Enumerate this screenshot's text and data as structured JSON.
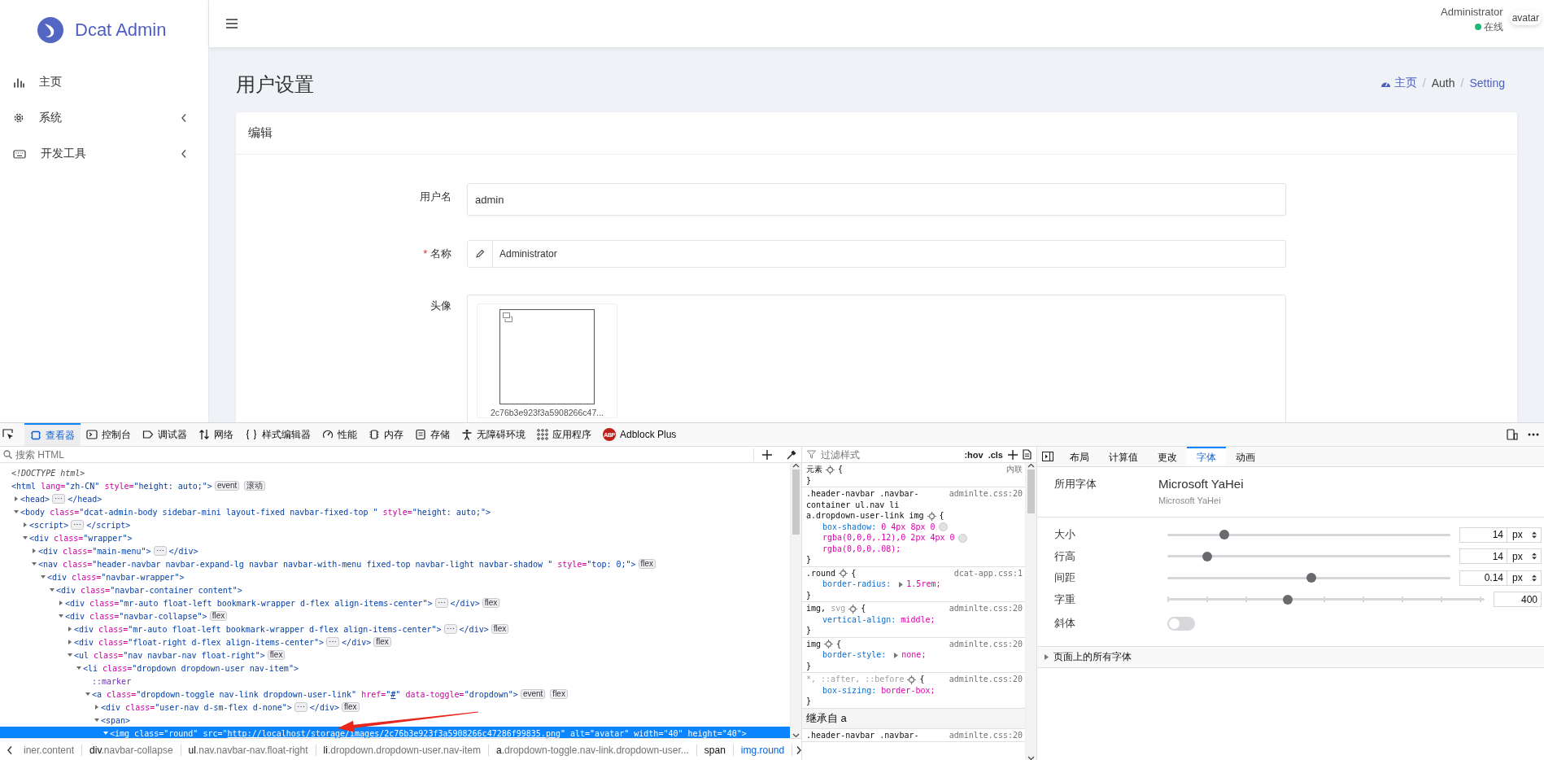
{
  "sidebar": {
    "logo": "Dcat Admin",
    "items": [
      {
        "label": "主页",
        "expandable": false
      },
      {
        "label": "系统",
        "expandable": true
      },
      {
        "label": "开发工具",
        "expandable": true
      }
    ]
  },
  "header": {
    "user_name": "Administrator",
    "status": "在线",
    "avatar_alt": "avatar"
  },
  "content": {
    "title": "用户设置",
    "breadcrumb": [
      {
        "kind": "link",
        "label": "主页"
      },
      {
        "kind": "separator",
        "label": "/"
      },
      {
        "kind": "text",
        "label": "Auth"
      },
      {
        "kind": "separator",
        "label": "/"
      },
      {
        "kind": "link",
        "label": "Setting"
      }
    ],
    "card": {
      "title": "编辑",
      "fields": [
        {
          "kind": "text",
          "label": "用户名",
          "value": "admin"
        },
        {
          "kind": "icon-text",
          "label": "名称",
          "mark": "*",
          "value": "Administrator"
        },
        {
          "kind": "image",
          "label": "头像",
          "file_name": "2c76b3e923f3a5908266c47..."
        }
      ]
    }
  },
  "devtools": {
    "toolbar": {
      "tabs": [
        {
          "label": "查看器",
          "selected": true
        },
        {
          "label": "控制台",
          "selected": false
        },
        {
          "label": "调试器",
          "selected": false
        },
        {
          "label": "网络",
          "selected": false
        },
        {
          "label": "样式编辑器",
          "selected": false
        },
        {
          "label": "性能",
          "selected": false
        },
        {
          "label": "内存",
          "selected": false
        },
        {
          "label": "存储",
          "selected": false
        },
        {
          "label": "无障碍环境",
          "selected": false
        },
        {
          "label": "应用程序",
          "selected": false
        },
        {
          "label": "Adblock Plus",
          "selected": false,
          "badge": "ABP"
        }
      ]
    },
    "inspector": {
      "search_placeholder": "搜索 HTML",
      "tree": [
        {
          "selected": false,
          "parts": [
            {
              "kind": "doctype",
              "text": "<!DOCTYPE html>"
            }
          ]
        },
        {
          "selected": false,
          "parts": [
            {
              "kind": "tag",
              "text": "<html"
            },
            {
              "kind": "attr",
              "text": " lang="
            },
            {
              "kind": "value",
              "text": "\"zh-CN\""
            },
            {
              "kind": "attr",
              "text": " style="
            },
            {
              "kind": "value",
              "text": "\"height: auto;\""
            },
            {
              "kind": "tag",
              "text": ">"
            },
            {
              "kind": "badge",
              "text": "event"
            },
            {
              "kind": "badge",
              "text": "滚动"
            }
          ],
          "children": [
            {
              "selected": false,
              "expanded": false,
              "parts": [
                {
                  "kind": "tag",
                  "text": "<head>"
                },
                {
                  "kind": "badge",
                  "text": "⋯"
                },
                {
                  "kind": "tag",
                  "text": "</head>"
                }
              ]
            },
            {
              "selected": false,
              "expanded": true,
              "parts": [
                {
                  "kind": "tag",
                  "text": "<body"
                },
                {
                  "kind": "attr",
                  "text": " class="
                },
                {
                  "kind": "value",
                  "text": "\"dcat-admin-body sidebar-mini layout-fixed navbar-fixed-top \""
                },
                {
                  "kind": "attr",
                  "text": " style="
                },
                {
                  "kind": "value",
                  "text": "\"height: auto;\""
                },
                {
                  "kind": "tag",
                  "text": ">"
                }
              ],
              "children": [
                {
                  "selected": false,
                  "expanded": false,
                  "parts": [
                    {
                      "kind": "tag",
                      "text": "<script>"
                    },
                    {
                      "kind": "badge",
                      "text": "⋯"
                    },
                    {
                      "kind": "tag",
                      "text": "</script>"
                    }
                  ]
                },
                {
                  "selected": false,
                  "expanded": true,
                  "parts": [
                    {
                      "kind": "tag",
                      "text": "<div"
                    },
                    {
                      "kind": "attr",
                      "text": " class="
                    },
                    {
                      "kind": "value",
                      "text": "\"wrapper\""
                    },
                    {
                      "kind": "tag",
                      "text": ">"
                    }
                  ],
                  "children": [
                    {
                      "selected": false,
                      "expanded": false,
                      "parts": [
                        {
                          "kind": "tag",
                          "text": "<div"
                        },
                        {
                          "kind": "attr",
                          "text": " class="
                        },
                        {
                          "kind": "value",
                          "text": "\"main-menu\""
                        },
                        {
                          "kind": "tag",
                          "text": ">"
                        },
                        {
                          "kind": "badge",
                          "text": "⋯"
                        },
                        {
                          "kind": "tag",
                          "text": "</div>"
                        }
                      ]
                    },
                    {
                      "selected": false,
                      "expanded": true,
                      "parts": [
                        {
                          "kind": "tag",
                          "text": "<nav"
                        },
                        {
                          "kind": "attr",
                          "text": " class="
                        },
                        {
                          "kind": "value",
                          "text": "\"header-navbar navbar-expand-lg navbar navbar-with-menu fixed-top navbar-light navbar-shadow \""
                        },
                        {
                          "kind": "attr",
                          "text": " style="
                        },
                        {
                          "kind": "value",
                          "text": "\"top: 0;\""
                        },
                        {
                          "kind": "tag",
                          "text": ">"
                        },
                        {
                          "kind": "badge",
                          "text": "flex"
                        }
                      ],
                      "children": [
                        {
                          "selected": false,
                          "expanded": true,
                          "parts": [
                            {
                              "kind": "tag",
                              "text": "<div"
                            },
                            {
                              "kind": "attr",
                              "text": " class="
                            },
                            {
                              "kind": "value",
                              "text": "\"navbar-wrapper\""
                            },
                            {
                              "kind": "tag",
                              "text": ">"
                            }
                          ],
                          "children": [
                            {
                              "selected": false,
                              "expanded": true,
                              "parts": [
                                {
                                  "kind": "tag",
                                  "text": "<div"
                                },
                                {
                                  "kind": "attr",
                                  "text": " class="
                                },
                                {
                                  "kind": "value",
                                  "text": "\"navbar-container content\""
                                },
                                {
                                  "kind": "tag",
                                  "text": ">"
                                }
                              ],
                              "children": [
                                {
                                  "selected": false,
                                  "expanded": false,
                                  "parts": [
                                    {
                                      "kind": "tag",
                                      "text": "<div"
                                    },
                                    {
                                      "kind": "attr",
                                      "text": " class="
                                    },
                                    {
                                      "kind": "value",
                                      "text": "\"mr-auto float-left bookmark-wrapper d-flex align-items-center\""
                                    },
                                    {
                                      "kind": "tag",
                                      "text": ">"
                                    },
                                    {
                                      "kind": "badge",
                                      "text": "⋯"
                                    },
                                    {
                                      "kind": "tag",
                                      "text": "</div>"
                                    },
                                    {
                                      "kind": "badge",
                                      "text": "flex"
                                    }
                                  ]
                                },
                                {
                                  "selected": false,
                                  "expanded": true,
                                  "parts": [
                                    {
                                      "kind": "tag",
                                      "text": "<div"
                                    },
                                    {
                                      "kind": "attr",
                                      "text": " class="
                                    },
                                    {
                                      "kind": "value",
                                      "text": "\"navbar-collapse\""
                                    },
                                    {
                                      "kind": "tag",
                                      "text": ">"
                                    },
                                    {
                                      "kind": "badge",
                                      "text": "flex"
                                    }
                                  ],
                                  "children": [
                                    {
                                      "selected": false,
                                      "expanded": false,
                                      "parts": [
                                        {
                                          "kind": "tag",
                                          "text": "<div"
                                        },
                                        {
                                          "kind": "attr",
                                          "text": " class="
                                        },
                                        {
                                          "kind": "value",
                                          "text": "\"mr-auto float-left bookmark-wrapper d-flex align-items-center\""
                                        },
                                        {
                                          "kind": "tag",
                                          "text": ">"
                                        },
                                        {
                                          "kind": "badge",
                                          "text": "⋯"
                                        },
                                        {
                                          "kind": "tag",
                                          "text": "</div>"
                                        },
                                        {
                                          "kind": "badge",
                                          "text": "flex"
                                        }
                                      ]
                                    },
                                    {
                                      "selected": false,
                                      "expanded": false,
                                      "parts": [
                                        {
                                          "kind": "tag",
                                          "text": "<div"
                                        },
                                        {
                                          "kind": "attr",
                                          "text": " class="
                                        },
                                        {
                                          "kind": "value",
                                          "text": "\"float-right d-flex align-items-center\""
                                        },
                                        {
                                          "kind": "tag",
                                          "text": ">"
                                        },
                                        {
                                          "kind": "badge",
                                          "text": "⋯"
                                        },
                                        {
                                          "kind": "tag",
                                          "text": "</div>"
                                        },
                                        {
                                          "kind": "badge",
                                          "text": "flex"
                                        }
                                      ]
                                    },
                                    {
                                      "selected": false,
                                      "expanded": true,
                                      "parts": [
                                        {
                                          "kind": "tag",
                                          "text": "<ul"
                                        },
                                        {
                                          "kind": "attr",
                                          "text": " class="
                                        },
                                        {
                                          "kind": "value",
                                          "text": "\"nav navbar-nav float-right\""
                                        },
                                        {
                                          "kind": "tag",
                                          "text": ">"
                                        },
                                        {
                                          "kind": "badge",
                                          "text": "flex"
                                        }
                                      ],
                                      "children": [
                                        {
                                          "selected": false,
                                          "expanded": true,
                                          "parts": [
                                            {
                                              "kind": "tag",
                                              "text": "<li"
                                            },
                                            {
                                              "kind": "attr",
                                              "text": " class="
                                            },
                                            {
                                              "kind": "value",
                                              "text": "\"dropdown dropdown-user nav-item\""
                                            },
                                            {
                                              "kind": "tag",
                                              "text": ">"
                                            }
                                          ],
                                          "children": [
                                            {
                                              "selected": false,
                                              "parts": [
                                                {
                                                  "kind": "pseudo",
                                                  "text": "::marker"
                                                }
                                              ]
                                            },
                                            {
                                              "selected": false,
                                              "expanded": true,
                                              "parts": [
                                                {
                                                  "kind": "tag",
                                                  "text": "<a"
                                                },
                                                {
                                                  "kind": "attr",
                                                  "text": " class="
                                                },
                                                {
                                                  "kind": "value",
                                                  "text": "\"dropdown-toggle nav-link dropdown-user-link\""
                                                },
                                                {
                                                  "kind": "attr",
                                                  "text": " href="
                                                },
                                                {
                                                  "kind": "value",
                                                  "text": "\""
                                                },
                                                {
                                                  "kind": "link",
                                                  "text": "#"
                                                },
                                                {
                                                  "kind": "value",
                                                  "text": "\""
                                                },
                                                {
                                                  "kind": "attr",
                                                  "text": " data-toggle="
                                                },
                                                {
                                                  "kind": "value",
                                                  "text": "\"dropdown\""
                                                },
                                                {
                                                  "kind": "tag",
                                                  "text": ">"
                                                },
                                                {
                                                  "kind": "badge",
                                                  "text": "event"
                                                },
                                                {
                                                  "kind": "badge",
                                                  "text": "flex"
                                                }
                                              ],
                                              "children": [
                                                {
                                                  "selected": false,
                                                  "expanded": false,
                                                  "parts": [
                                                    {
                                                      "kind": "tag",
                                                      "text": "<div"
                                                    },
                                                    {
                                                      "kind": "attr",
                                                      "text": " class="
                                                    },
                                                    {
                                                      "kind": "value",
                                                      "text": "\"user-nav d-sm-flex d-none\""
                                                    },
                                                    {
                                                      "kind": "tag",
                                                      "text": ">"
                                                    },
                                                    {
                                                      "kind": "badge",
                                                      "text": "⋯"
                                                    },
                                                    {
                                                      "kind": "tag",
                                                      "text": "</div>"
                                                    },
                                                    {
                                                      "kind": "badge",
                                                      "text": "flex"
                                                    }
                                                  ]
                                                },
                                                {
                                                  "selected": false,
                                                  "expanded": true,
                                                  "parts": [
                                                    {
                                                      "kind": "tag",
                                                      "text": "<span>"
                                                    }
                                                  ],
                                                  "children": [
                                                    {
                                                      "selected": true,
                                                      "expanded": true,
                                                      "parts": [
                                                        {
                                                          "kind": "tag",
                                                          "text": "<img"
                                                        },
                                                        {
                                                          "kind": "attr",
                                                          "text": " class="
                                                        },
                                                        {
                                                          "kind": "value",
                                                          "text": "\"round\""
                                                        },
                                                        {
                                                          "kind": "attr",
                                                          "text": " src="
                                                        },
                                                        {
                                                          "kind": "value",
                                                          "text": "\""
                                                        },
                                                        {
                                                          "kind": "link",
                                                          "text": "http://localhost/storage/images/2c76b3e923f3a5908266c47286f99835.png"
                                                        },
                                                        {
                                                          "kind": "value",
                                                          "text": "\""
                                                        },
                                                        {
                                                          "kind": "attr",
                                                          "text": " alt="
                                                        },
                                                        {
                                                          "kind": "value",
                                                          "text": "\"avatar\""
                                                        },
                                                        {
                                                          "kind": "attr",
                                                          "text": " width="
                                                        },
                                                        {
                                                          "kind": "value",
                                                          "text": "\"40\""
                                                        },
                                                        {
                                                          "kind": "attr",
                                                          "text": " height="
                                                        },
                                                        {
                                                          "kind": "value",
                                                          "text": "\"40\""
                                                        },
                                                        {
                                                          "kind": "tag",
                                                          "text": ">"
                                                        }
                                                      ]
                                                    }
                                                  ]
                                                }
                                              ]
                                            }
                                          ]
                                        }
                                      ]
                                    }
                                  ]
                                }
                              ]
                            }
                          ]
                        }
                      ]
                    }
                  ]
                }
              ]
            }
          ]
        }
      ],
      "breadcrumb": [
        {
          "text": "iner.content",
          "selected": false
        },
        {
          "tag": "div",
          "text": ".navbar-collapse",
          "selected": false
        },
        {
          "tag": "ul",
          "text": ".nav.navbar-nav.float-right",
          "selected": false
        },
        {
          "tag": "li",
          "text": ".dropdown.dropdown-user.nav-item",
          "selected": false
        },
        {
          "tag": "a",
          "text": ".dropdown-toggle.nav-link.dropdown-user...",
          "selected": false
        },
        {
          "tag": "span",
          "selected": false
        },
        {
          "tag": "img",
          "text": ".round",
          "selected": true
        }
      ]
    },
    "rules": {
      "filter_placeholder": "过滤样式",
      "hov": ":hov",
      "cls": ".cls",
      "rules": [
        {
          "kind": "rule",
          "selector": [
            {
              "text": "元素",
              "matched": true
            }
          ],
          "source": "内联",
          "open": "{",
          "close": "}"
        },
        {
          "kind": "rule",
          "selector": [
            {
              "text": ".header-navbar .navbar-container ul.nav li a.dropdown-user-link img",
              "matched": true
            }
          ],
          "source": "adminlte.css:20",
          "open": "{",
          "close": "}",
          "declarations": [
            {
              "property": "box-shadow:",
              "expandable": false,
              "value": [
                {
                  "text": "0 4px 8px 0",
                  "swatch": true
                },
                {
                  "text": "rgba(0,0,0,.12),0 2px 4px 0",
                  "swatch": true
                },
                {
                  "text": "rgba(0,0,0,.08);",
                  "swatch": false
                }
              ]
            }
          ]
        },
        {
          "kind": "rule",
          "selector": [
            {
              "text": ".round",
              "matched": true
            }
          ],
          "source": "dcat-app.css:1",
          "open": "{",
          "close": "}",
          "declarations": [
            {
              "property": "border-radius:",
              "expandable": true,
              "value": [
                {
                  "text": "1.5rem;",
                  "swatch": false
                }
              ]
            }
          ]
        },
        {
          "kind": "rule",
          "selector": [
            {
              "text": "img,",
              "matched": true
            },
            {
              "text": "svg",
              "matched": false
            }
          ],
          "source": "adminlte.css:20",
          "open": "{",
          "close": "}",
          "declarations": [
            {
              "property": "vertical-align:",
              "expandable": false,
              "value": [
                {
                  "text": "middle;",
                  "swatch": false
                }
              ]
            }
          ]
        },
        {
          "kind": "rule",
          "selector": [
            {
              "text": "img",
              "matched": true
            }
          ],
          "source": "adminlte.css:20",
          "open": "{",
          "close": "}",
          "declarations": [
            {
              "property": "border-style:",
              "expandable": true,
              "value": [
                {
                  "text": "none;",
                  "swatch": false
                }
              ]
            }
          ]
        },
        {
          "kind": "rule",
          "selector": [
            {
              "text": "*, ::after, ::before",
              "matched": false
            }
          ],
          "source": "adminlte.css:20",
          "open": "{",
          "close": "}",
          "declarations": [
            {
              "property": "box-sizing:",
              "expandable": false,
              "value": [
                {
                  "text": "border-box;",
                  "swatch": false
                }
              ]
            }
          ]
        },
        {
          "kind": "inherited",
          "label": "继承自 a"
        },
        {
          "kind": "rule",
          "selector": [
            {
              "text": ".header-navbar .navbar-",
              "matched": true
            }
          ],
          "source": "adminlte.css:20"
        }
      ]
    },
    "fonts": {
      "tabs": [
        {
          "label": "布局",
          "selected": false
        },
        {
          "label": "计算值",
          "selected": false
        },
        {
          "label": "更改",
          "selected": false
        },
        {
          "label": "字体",
          "selected": true
        },
        {
          "label": "动画",
          "selected": false
        }
      ],
      "used_label": "所用字体",
      "font_name": "Microsoft YaHei",
      "font_source": "Microsoft YaHei",
      "settings": [
        {
          "kind": "slider",
          "label": "大小",
          "level": 0.2,
          "value": "14",
          "unit": "px"
        },
        {
          "kind": "slider",
          "label": "行高",
          "level": 0.14,
          "value": "14",
          "unit": "px"
        },
        {
          "kind": "slider",
          "label": "间距",
          "level": 0.51,
          "value": "0.14",
          "unit": "px"
        },
        {
          "kind": "ticked-slider",
          "label": "字重",
          "level": 0.38,
          "value": "400"
        },
        {
          "kind": "toggle",
          "label": "斜体",
          "on": false
        }
      ],
      "all_fonts": "页面上的所有字体"
    }
  }
}
